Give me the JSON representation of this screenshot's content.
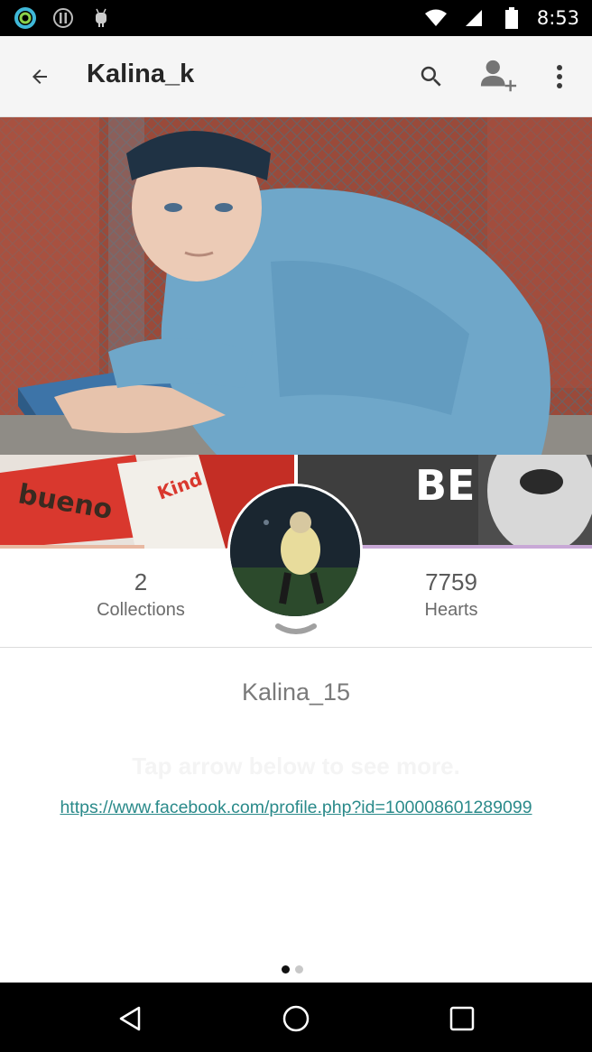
{
  "status_bar": {
    "time": "8:53",
    "icons": [
      "circle-status-icon",
      "alert-icon",
      "android-icon",
      "wifi-icon",
      "signal-icon",
      "battery-icon"
    ]
  },
  "app_bar": {
    "title": "Kalina_k",
    "icons": [
      "back-arrow-icon",
      "search-icon",
      "add-user-icon",
      "more-vert-icon"
    ]
  },
  "profile": {
    "collections_count": "2",
    "collections_label": "Collections",
    "hearts_count": "7759",
    "hearts_label": "Hearts",
    "username": "Kalina_15",
    "hint": "Tap arrow below to see more.",
    "link": "https://www.facebook.com/profile.php?id=100008601289099",
    "thumb_right_text": "BE"
  },
  "pager": {
    "active_index": 0,
    "count": 2
  },
  "colors": {
    "link": "#2a8a8a",
    "app_bar_bg": "#f5f5f5"
  }
}
